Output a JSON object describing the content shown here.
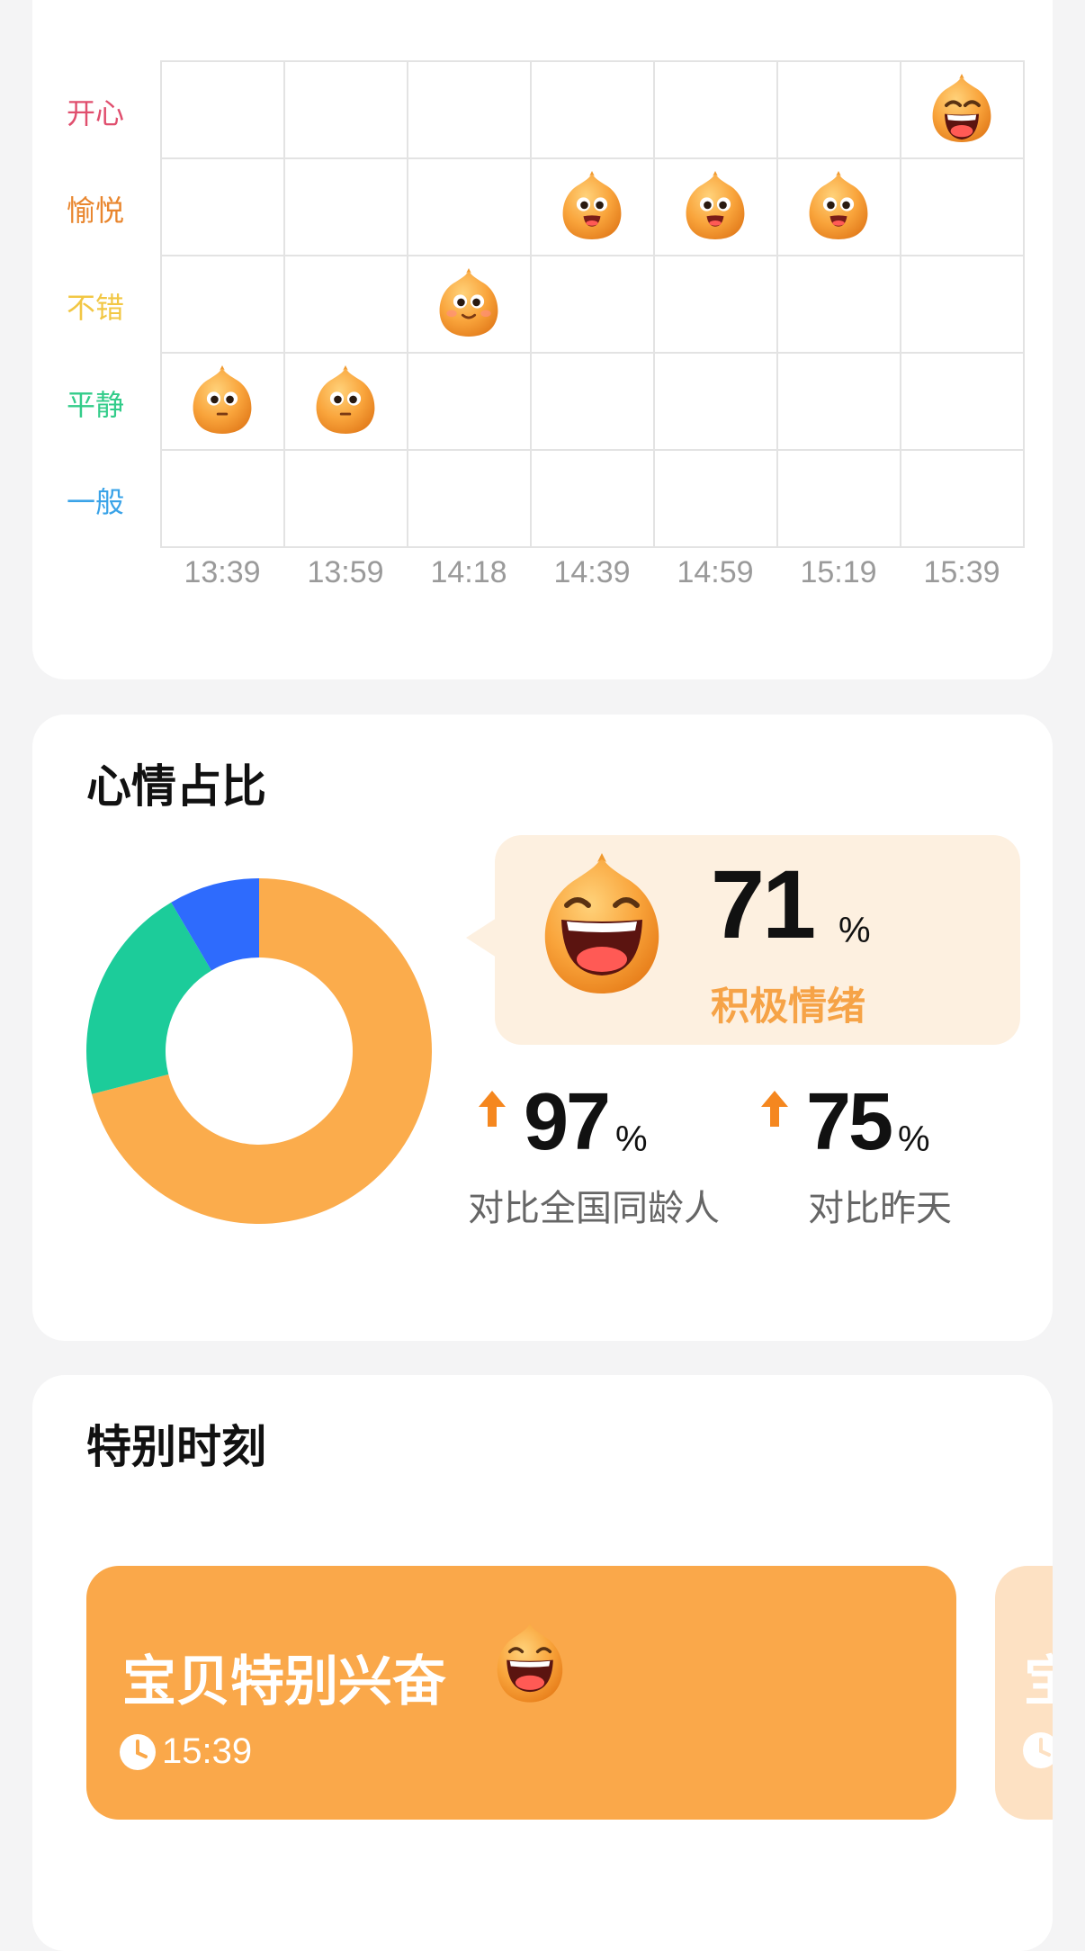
{
  "mood_timeline": {
    "y_labels": [
      {
        "label": "开心",
        "color": "#e04f6e"
      },
      {
        "label": "愉悦",
        "color": "#e9862e"
      },
      {
        "label": "不错",
        "color": "#f2c744"
      },
      {
        "label": "平静",
        "color": "#33cc8a"
      },
      {
        "label": "一般",
        "color": "#3aa3e8"
      }
    ],
    "x_labels": [
      "13:39",
      "13:59",
      "14:18",
      "14:39",
      "14:59",
      "15:19",
      "15:39"
    ],
    "points": [
      {
        "time": "13:39",
        "mood": "平静",
        "icon": "calm-face-icon"
      },
      {
        "time": "13:59",
        "mood": "平静",
        "icon": "calm-face-icon"
      },
      {
        "time": "14:18",
        "mood": "不错",
        "icon": "smile-face-icon"
      },
      {
        "time": "14:39",
        "mood": "愉悦",
        "icon": "grin-face-icon"
      },
      {
        "time": "14:59",
        "mood": "愉悦",
        "icon": "grin-face-icon"
      },
      {
        "time": "15:19",
        "mood": "愉悦",
        "icon": "grin-face-icon"
      },
      {
        "time": "15:39",
        "mood": "开心",
        "icon": "laugh-face-icon"
      }
    ]
  },
  "mood_ratio": {
    "title": "心情占比",
    "positive": {
      "value": "71",
      "unit": "%",
      "label": "积极情绪"
    },
    "compare_peers": {
      "value": "97",
      "unit": "%",
      "label": "对比全国同龄人",
      "trend": "up"
    },
    "compare_yesterday": {
      "value": "75",
      "unit": "%",
      "label": "对比昨天",
      "trend": "up"
    },
    "colors": {
      "positive": "#fbac4c",
      "calm": "#1ccc9a",
      "normal": "#2e6bfd"
    }
  },
  "chart_data": {
    "type": "pie",
    "style": "donut",
    "slices": [
      {
        "value": 71,
        "color": "#fbac4c"
      },
      {
        "value": 20.5,
        "color": "#1ccc9a"
      },
      {
        "value": 8.5,
        "color": "#2e6bfd"
      }
    ]
  },
  "special_moments": {
    "title": "特别时刻",
    "items": [
      {
        "title": "宝贝特别兴奋",
        "time": "15:39",
        "icon": "laugh-face-icon"
      },
      {
        "title": "宝",
        "time": ""
      }
    ]
  },
  "theme": {
    "accent": "#faa84a",
    "arrow": "#f5871f",
    "background": "#f4f4f5"
  }
}
